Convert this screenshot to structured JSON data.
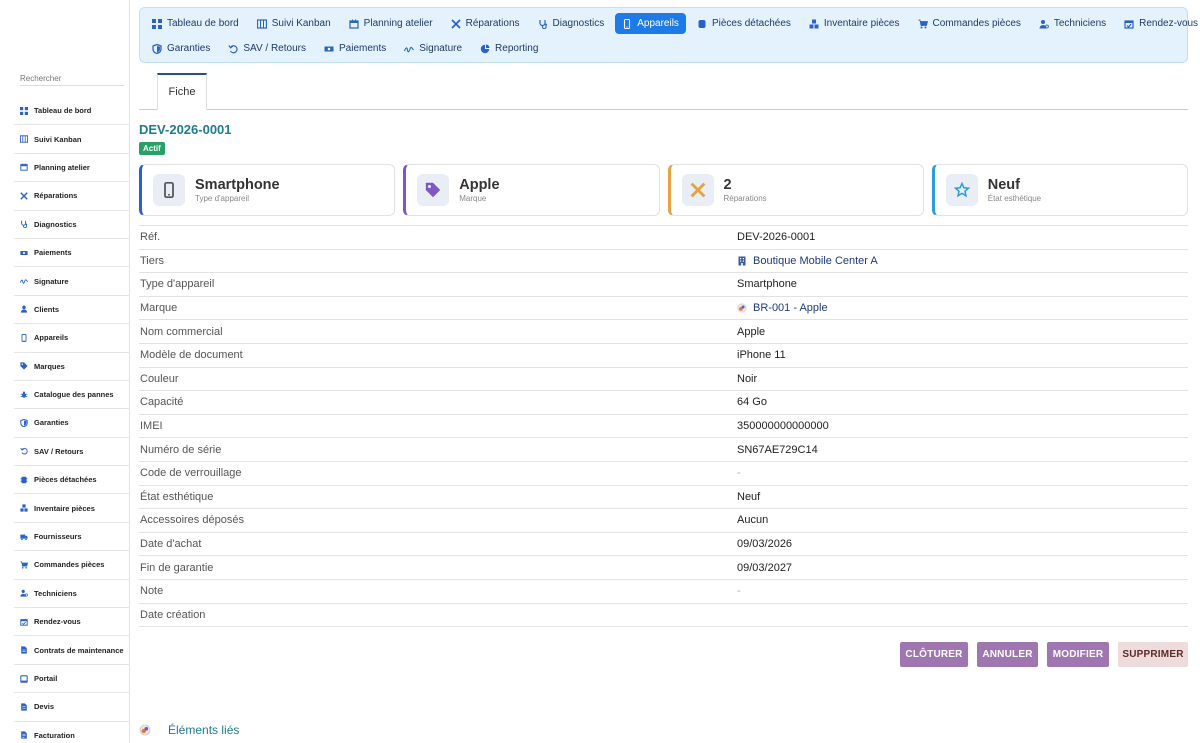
{
  "search": {
    "placeholder": "Rechercher"
  },
  "sidebar": {
    "items": [
      {
        "label": "Tableau de bord",
        "icon": "dashboard-icon"
      },
      {
        "label": "Suivi Kanban",
        "icon": "kanban-icon"
      },
      {
        "label": "Planning atelier",
        "icon": "calendar-icon"
      },
      {
        "label": "Réparations",
        "icon": "tools-icon"
      },
      {
        "label": "Diagnostics",
        "icon": "stethoscope-icon"
      },
      {
        "label": "Paiements",
        "icon": "money-icon"
      },
      {
        "label": "Signature",
        "icon": "signature-icon"
      },
      {
        "label": "Clients",
        "icon": "user-icon"
      },
      {
        "label": "Appareils",
        "icon": "mobile-icon"
      },
      {
        "label": "Marques",
        "icon": "tag-icon"
      },
      {
        "label": "Catalogue des pannes",
        "icon": "bug-icon"
      },
      {
        "label": "Garanties",
        "icon": "shield-icon"
      },
      {
        "label": "SAV / Retours",
        "icon": "undo-icon"
      },
      {
        "label": "Pièces détachées",
        "icon": "chip-icon"
      },
      {
        "label": "Inventaire pièces",
        "icon": "boxes-icon"
      },
      {
        "label": "Fournisseurs",
        "icon": "truck-icon"
      },
      {
        "label": "Commandes pièces",
        "icon": "cart-icon"
      },
      {
        "label": "Techniciens",
        "icon": "user-gear-icon"
      },
      {
        "label": "Rendez-vous",
        "icon": "calendar-check-icon"
      },
      {
        "label": "Contrats de maintenance",
        "icon": "contract-icon"
      },
      {
        "label": "Portail",
        "icon": "portal-icon"
      },
      {
        "label": "Devis",
        "icon": "file-icon"
      },
      {
        "label": "Facturation",
        "icon": "invoice-icon"
      }
    ]
  },
  "topnav": {
    "row1": [
      {
        "label": "Tableau de bord",
        "icon": "dashboard-icon"
      },
      {
        "label": "Suivi Kanban",
        "icon": "kanban-icon"
      },
      {
        "label": "Planning atelier",
        "icon": "calendar-icon"
      },
      {
        "label": "Réparations",
        "icon": "tools-icon"
      },
      {
        "label": "Diagnostics",
        "icon": "stethoscope-icon"
      },
      {
        "label": "Appareils",
        "icon": "mobile-icon",
        "active": true
      },
      {
        "label": "Pièces détachées",
        "icon": "chip-icon"
      },
      {
        "label": "Inventaire pièces",
        "icon": "boxes-icon"
      },
      {
        "label": "Commandes pièces",
        "icon": "cart-icon"
      },
      {
        "label": "Techniciens",
        "icon": "user-gear-icon"
      },
      {
        "label": "Rendez-vous",
        "icon": "calendar-check-icon"
      }
    ],
    "row2": [
      {
        "label": "Garanties",
        "icon": "shield-icon"
      },
      {
        "label": "SAV / Retours",
        "icon": "undo-icon"
      },
      {
        "label": "Paiements",
        "icon": "money-icon"
      },
      {
        "label": "Signature",
        "icon": "signature-icon"
      },
      {
        "label": "Reporting",
        "icon": "pie-chart-icon"
      }
    ]
  },
  "tab": {
    "label": "Fiche"
  },
  "record": {
    "ref": "DEV-2026-0001",
    "status": "Actif"
  },
  "cards": [
    {
      "value": "Smartphone",
      "label": "Type d'appareil",
      "icon": "mobile-icon",
      "accent": "#2a62c9"
    },
    {
      "value": "Apple",
      "label": "Marque",
      "icon": "tag-icon",
      "accent": "#7e57c2"
    },
    {
      "value": "2",
      "label": "Réparations",
      "icon": "tools-icon",
      "accent": "#e8a23a"
    },
    {
      "value": "Neuf",
      "label": "État esthétique",
      "icon": "star-icon",
      "accent": "#2a9fd6"
    }
  ],
  "fields": [
    {
      "key": "Réf.",
      "value": "DEV-2026-0001"
    },
    {
      "key": "Tiers",
      "value": "Boutique Mobile Center A",
      "icon": "building-icon",
      "link": true
    },
    {
      "key": "Type d'appareil",
      "value": "Smartphone"
    },
    {
      "key": "Marque",
      "value": "BR-001 - Apple",
      "icon": "brand-icon",
      "link": true
    },
    {
      "key": "Nom commercial",
      "value": "Apple"
    },
    {
      "key": "Modèle de document",
      "value": "iPhone 11"
    },
    {
      "key": "Couleur",
      "value": "Noir"
    },
    {
      "key": "Capacité",
      "value": "64 Go"
    },
    {
      "key": "IMEI",
      "value": "350000000000000"
    },
    {
      "key": "Numéro de série",
      "value": "SN67AE729C14"
    },
    {
      "key": "Code de verrouillage",
      "value": "-",
      "muted": true
    },
    {
      "key": "État esthétique",
      "value": "Neuf"
    },
    {
      "key": "Accessoires déposés",
      "value": "Aucun"
    },
    {
      "key": "Date d'achat",
      "value": "09/03/2026"
    },
    {
      "key": "Fin de garantie",
      "value": "09/03/2027"
    },
    {
      "key": "Note",
      "value": "-",
      "muted": true
    },
    {
      "key": "Date création",
      "value": ""
    }
  ],
  "actions": {
    "close": "CLÔTURER",
    "cancel": "ANNULER",
    "edit": "MODIFIER",
    "delete": "SUPPRIMER"
  },
  "linked": {
    "label": "Éléments liés",
    "icon": "brand-icon"
  },
  "colors": {
    "primary": "#1e7ae6",
    "nav_bg": "#e3f2fc",
    "teal": "#1d7b90",
    "button": "#a076b0",
    "badge": "#27a266"
  }
}
